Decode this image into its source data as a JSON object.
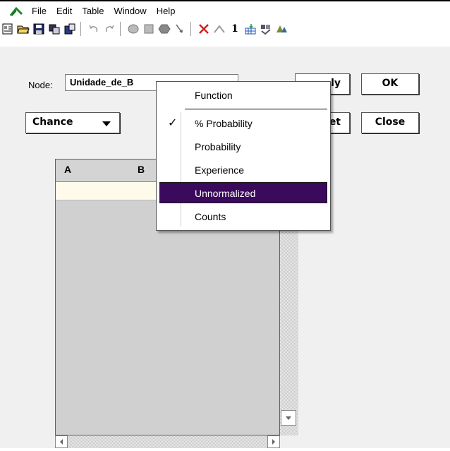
{
  "menubar": {
    "items": [
      "File",
      "Edit",
      "Table",
      "Window",
      "Help"
    ]
  },
  "toolbar": {
    "icons": [
      "new-icon",
      "open-icon",
      "save-icon",
      "copy-icon",
      "paste-icon",
      "undo-icon",
      "redo-icon",
      "circle-node-icon",
      "square-node-icon",
      "hexagon-node-icon",
      "arrow-icon",
      "delete-link-icon",
      "peak-icon",
      "number-one-icon",
      "table-icon",
      "compile-icon",
      "learn-icon"
    ],
    "one_label": "1"
  },
  "editor": {
    "node_label": "Node:",
    "node_value": "Unidade_de_B",
    "node_type": "Chance",
    "apply_label": "ly",
    "ok_label": "OK",
    "reset_label": "et",
    "close_label": "Close"
  },
  "table": {
    "headers": [
      "A",
      "B"
    ]
  },
  "dropdown": {
    "items": [
      "Function",
      "% Probability",
      "Probability",
      "Experience",
      "Unnormalized",
      "Counts"
    ],
    "checked": "% Probability",
    "selected": "Unnormalized",
    "check_mark": "✓"
  },
  "colors": {
    "selection": "#3b0a5c",
    "row_bg": "#fffbea",
    "logo": "#1a8a2a"
  }
}
